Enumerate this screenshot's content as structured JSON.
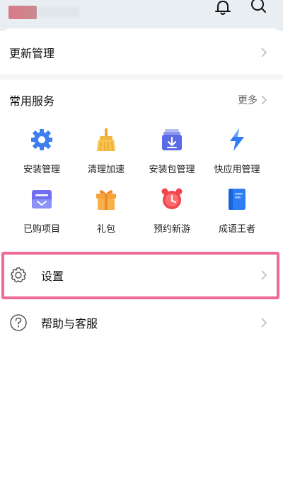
{
  "update": {
    "label": "更新管理"
  },
  "services": {
    "title": "常用服务",
    "more": "更多",
    "items": [
      {
        "label": "安装管理",
        "icon": "gear-icon"
      },
      {
        "label": "清理加速",
        "icon": "broom-icon"
      },
      {
        "label": "安装包管理",
        "icon": "package-icon"
      },
      {
        "label": "快应用管理",
        "icon": "lightning-icon"
      },
      {
        "label": "已购项目",
        "icon": "purchased-tray-icon"
      },
      {
        "label": "礼包",
        "icon": "gift-icon"
      },
      {
        "label": "预约新游",
        "icon": "alarm-clock-icon"
      },
      {
        "label": "成语王者",
        "icon": "book-icon"
      }
    ]
  },
  "menu": {
    "settings": "设置",
    "help": "帮助与客服"
  },
  "colors": {
    "highlight": "#ef6a9a",
    "accent_blue": "#3d7ff0",
    "accent_orange": "#f5a623",
    "accent_red": "#f0474f"
  }
}
